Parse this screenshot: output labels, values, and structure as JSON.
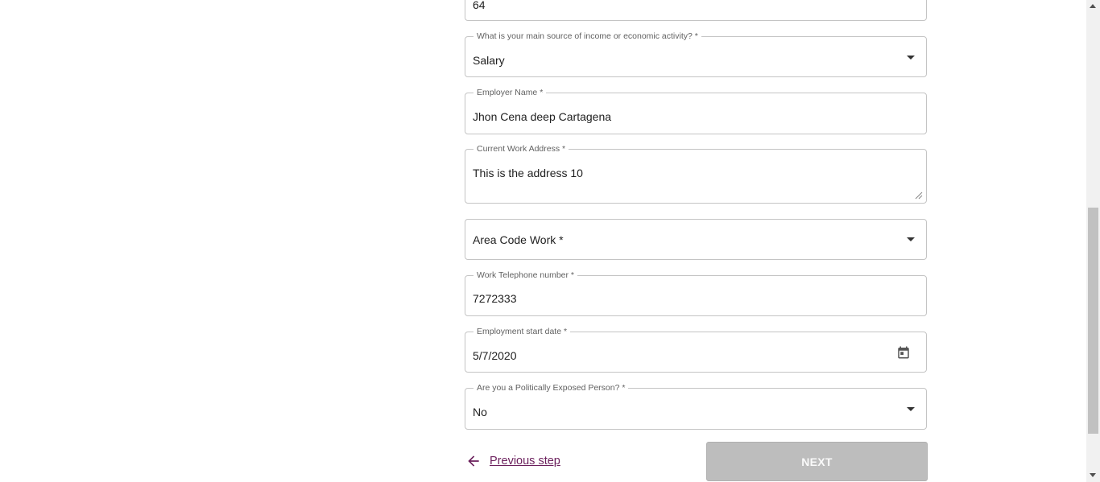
{
  "form": {
    "age_field": {
      "value": "64"
    },
    "income_source": {
      "label": "What is your main source of income or economic activity? *",
      "value": "Salary",
      "icon": "chevron-down-icon"
    },
    "employer_name": {
      "label": "Employer Name *",
      "value": "Jhon Cena deep Cartagena"
    },
    "work_address": {
      "label": "Current Work Address *",
      "value": "This is the address 10"
    },
    "area_code_work": {
      "label": "Area Code Work *",
      "icon": "chevron-down-icon"
    },
    "work_phone": {
      "label": "Work Telephone number *",
      "value": "7272333"
    },
    "employment_start": {
      "label": "Employment start date *",
      "value": "5/7/2020",
      "icon": "calendar-icon"
    },
    "pep": {
      "label": "Are you a Politically Exposed Person? *",
      "value": "No",
      "icon": "chevron-down-icon"
    }
  },
  "navigation": {
    "previous_label": "Previous step",
    "previous_icon": "arrow-left-icon",
    "next_label": "NEXT"
  },
  "colors": {
    "accent": "#6b1f5c",
    "disabled_button": "#bdbdbd",
    "border": "#c4c4c4"
  }
}
